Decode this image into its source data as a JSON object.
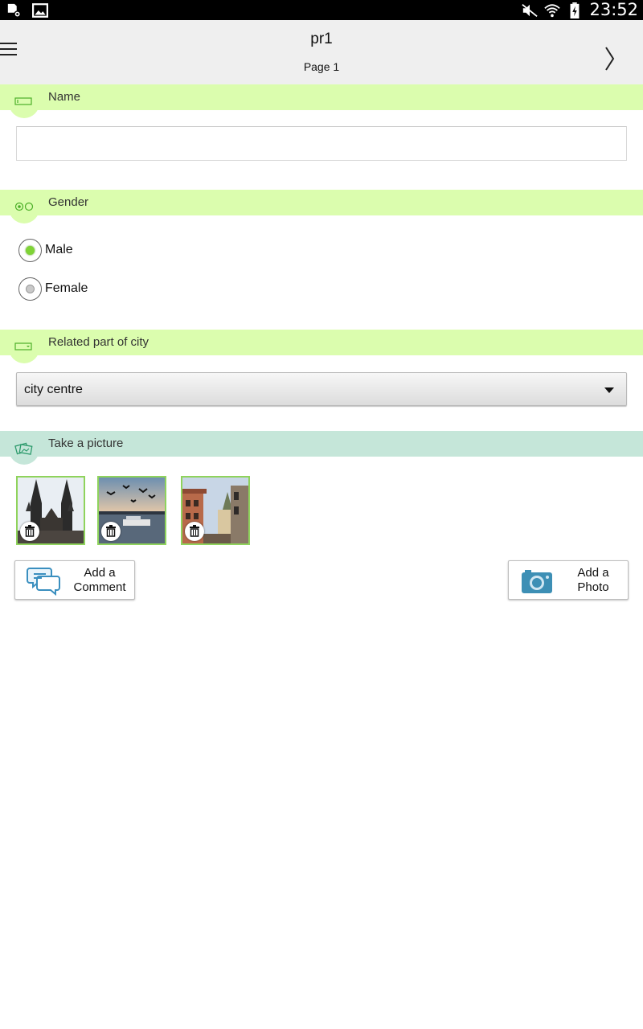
{
  "status_bar": {
    "time": "23:52",
    "left_icons": [
      "sd-card-settings-icon",
      "image-icon"
    ],
    "right_icons": [
      "mute-icon",
      "wifi-icon",
      "battery-charging-icon"
    ]
  },
  "header": {
    "title": "pr1",
    "subtitle": "Page 1",
    "menu_icon": "hamburger-menu-icon",
    "next_icon": "chevron-right-icon"
  },
  "sections": {
    "name": {
      "label": "Name",
      "value": "",
      "placeholder": ""
    },
    "gender": {
      "label": "Gender",
      "options": [
        {
          "label": "Male",
          "selected": true
        },
        {
          "label": "Female",
          "selected": false
        }
      ]
    },
    "city_part": {
      "label": "Related part of city",
      "selected": "city centre"
    },
    "picture": {
      "label": "Take a picture",
      "photos": [
        "cathedral-towers",
        "birds-over-river",
        "old-town-street"
      ]
    }
  },
  "actions": {
    "comment": {
      "line1": "Add a",
      "line2": "Comment"
    },
    "photo": {
      "line1": "Add a",
      "line2": "Photo"
    }
  },
  "colors": {
    "section_bar": "#dbfdae",
    "picture_bar": "#c5e6d9",
    "accent_green": "#7fd336",
    "thumb_border": "#8fd35c",
    "camera_blue": "#3d8fb5"
  }
}
